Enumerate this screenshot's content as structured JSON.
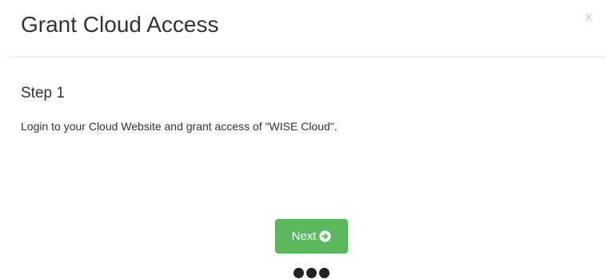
{
  "dialog": {
    "title": "Grant Cloud Access",
    "close_label": "x"
  },
  "step": {
    "title": "Step 1",
    "description": "Login to your Cloud Website and grant access of \"WISE Cloud\"."
  },
  "actions": {
    "next_label": "Next",
    "next_icon": "arrow-circle-right-icon"
  },
  "progress": {
    "total_steps": 3,
    "current_step": 1
  },
  "colors": {
    "primary_button": "#5cb85c",
    "divider": "#e5e5e5",
    "text": "#333333",
    "close": "#c8c8c8",
    "dot": "#222222"
  }
}
